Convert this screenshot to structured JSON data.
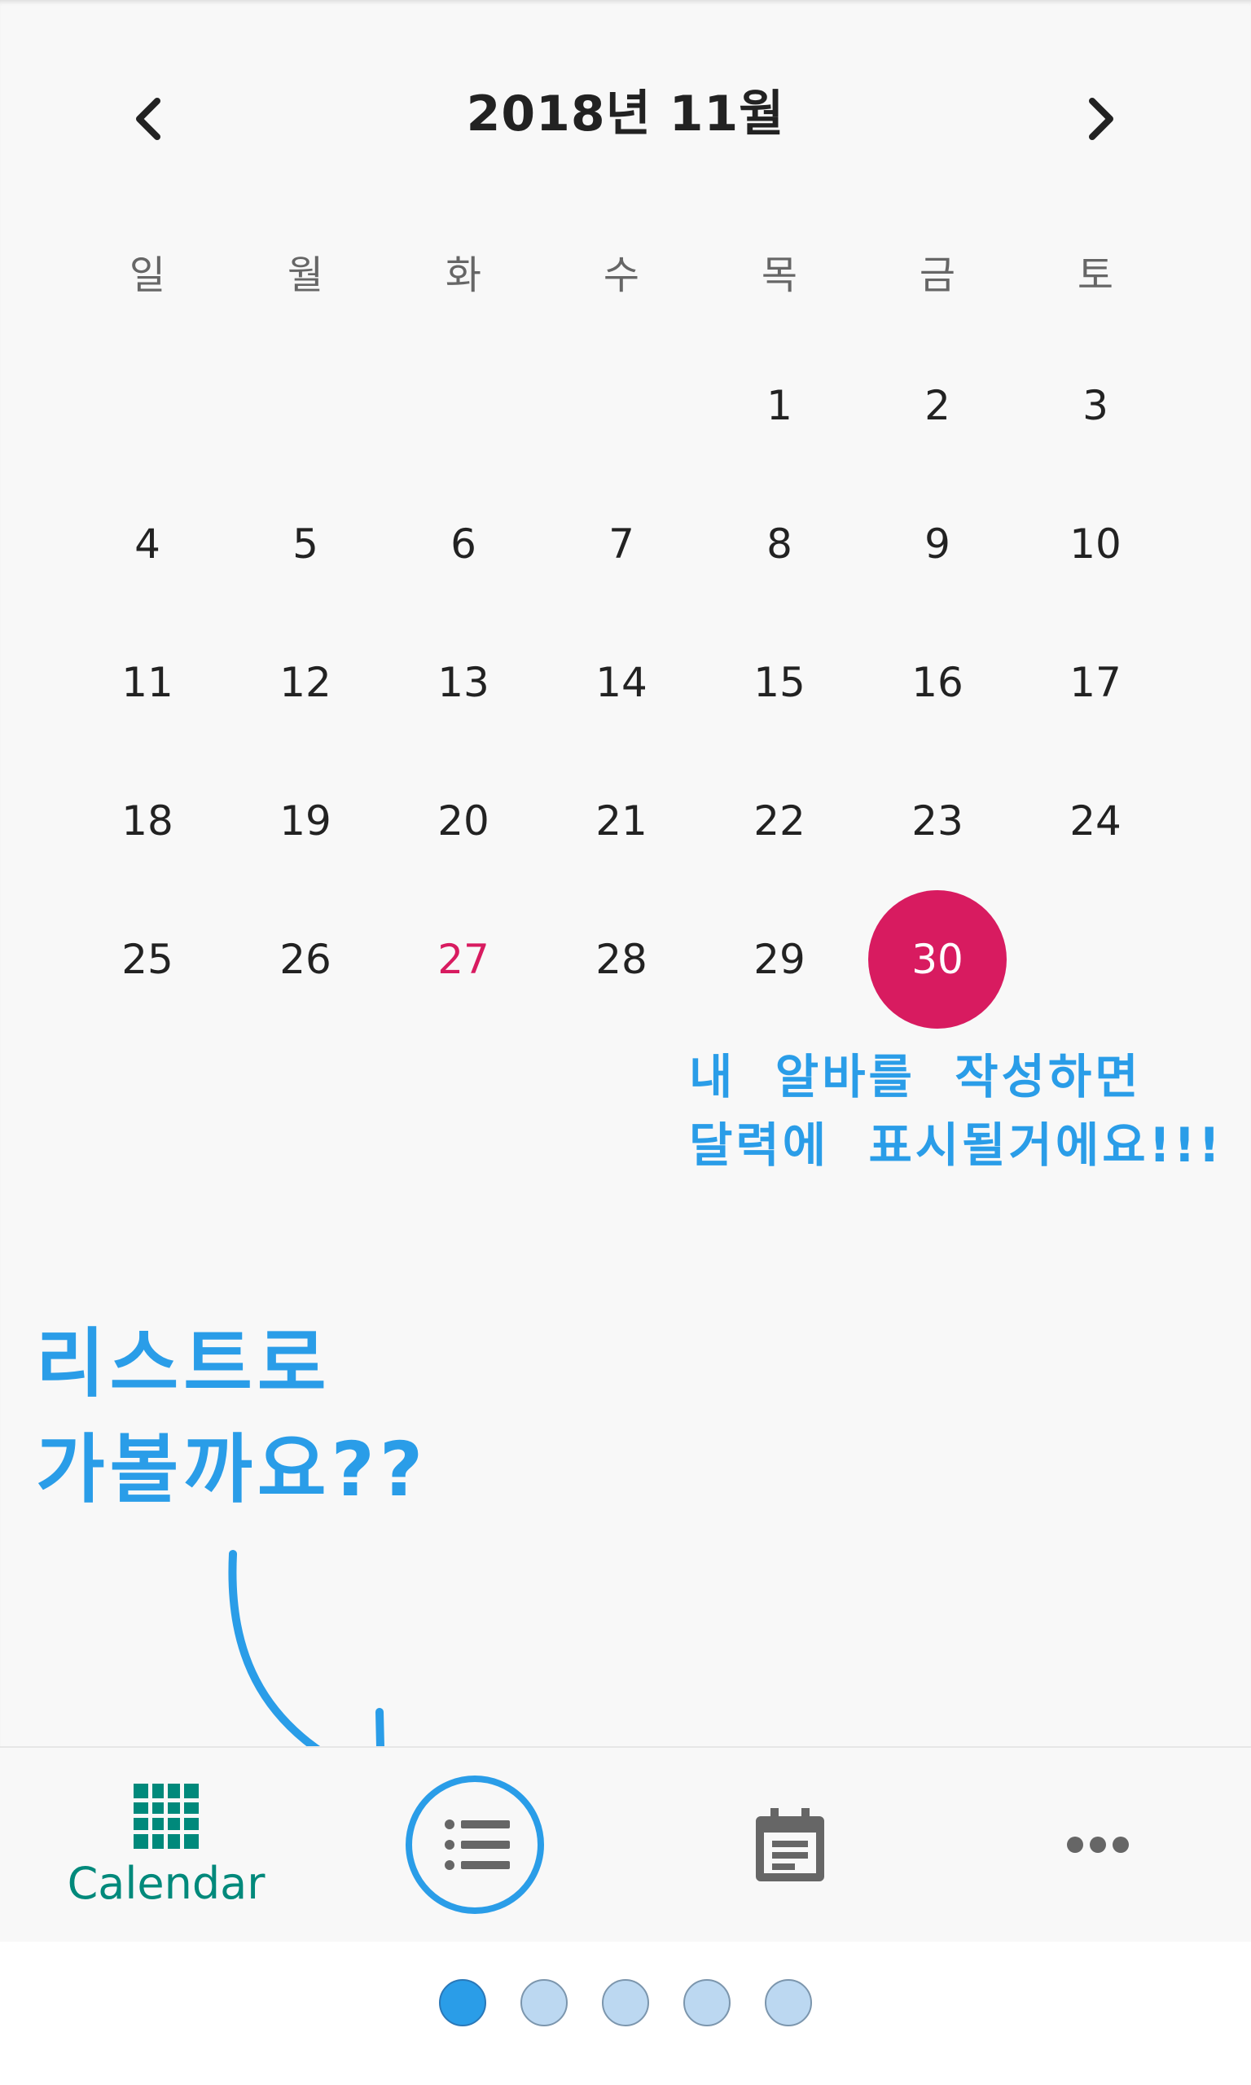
{
  "header": {
    "month_title": "2018년 11월",
    "prev_icon": "chevron-left-icon",
    "next_icon": "chevron-right-icon"
  },
  "weekdays": [
    "일",
    "월",
    "화",
    "수",
    "목",
    "금",
    "토"
  ],
  "weeks": [
    [
      "",
      "",
      "",
      "",
      "1",
      "2",
      "3"
    ],
    [
      "4",
      "5",
      "6",
      "7",
      "8",
      "9",
      "10"
    ],
    [
      "11",
      "12",
      "13",
      "14",
      "15",
      "16",
      "17"
    ],
    [
      "18",
      "19",
      "20",
      "21",
      "22",
      "23",
      "24"
    ],
    [
      "25",
      "26",
      "27",
      "28",
      "29",
      "30",
      ""
    ]
  ],
  "highlighted_day": "27",
  "selected_day": "30",
  "colors": {
    "accent_red": "#d81b60",
    "annotation_blue": "#2a9de8",
    "calendar_green": "#00897b",
    "icon_gray": "#666666"
  },
  "annotations": {
    "calendar_note": "내  알바를  작성하면\n달력에  표시될거에요!!!",
    "list_note": "리스트로\n가볼까요??"
  },
  "bottom_nav": {
    "items": [
      {
        "icon": "grid-calendar-icon",
        "label": "Calendar",
        "active": true
      },
      {
        "icon": "list-icon",
        "label": ""
      },
      {
        "icon": "event-note-icon",
        "label": ""
      },
      {
        "icon": "more-horiz-icon",
        "label": ""
      }
    ]
  },
  "page_indicator": {
    "count": 5,
    "active_index": 0
  }
}
